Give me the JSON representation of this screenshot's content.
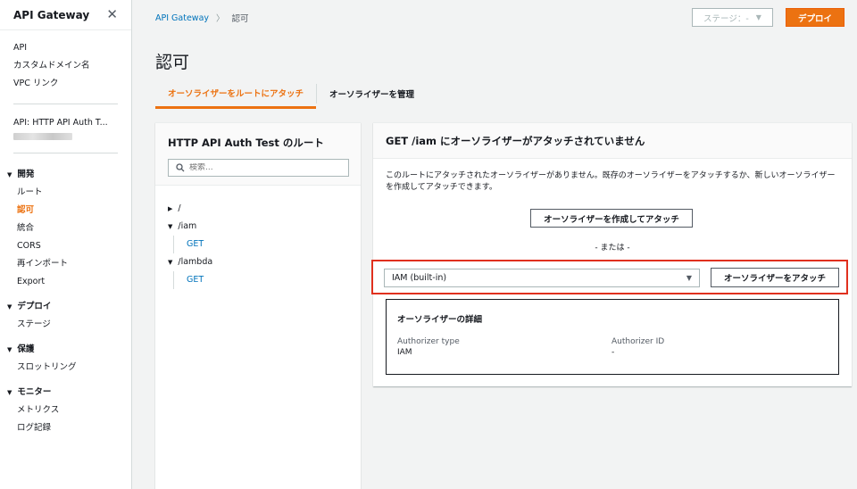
{
  "sidebar": {
    "title": "API Gateway",
    "top_links": [
      "API",
      "カスタムドメイン名",
      "VPC リンク"
    ],
    "api_name": "API: HTTP API Auth T...",
    "groups": [
      {
        "label": "開発",
        "items": [
          "ルート",
          "認可",
          "統合",
          "CORS",
          "再インポート",
          "Export"
        ]
      },
      {
        "label": "デプロイ",
        "items": [
          "ステージ"
        ]
      },
      {
        "label": "保護",
        "items": [
          "スロットリング"
        ]
      },
      {
        "label": "モニター",
        "items": [
          "メトリクス",
          "ログ記録"
        ]
      }
    ],
    "active_item": "認可"
  },
  "breadcrumb": {
    "root": "API Gateway",
    "current": "認可"
  },
  "stage_select": {
    "label": "ステージ：-"
  },
  "deploy_button": "デプロイ",
  "page_title": "認可",
  "tabs": [
    "オーソライザーをルートにアタッチ",
    "オーソライザーを管理"
  ],
  "routes_panel": {
    "title": "HTTP API Auth Test のルート",
    "search_placeholder": "検索...",
    "routes": [
      {
        "path": "/",
        "expanded": false,
        "methods": []
      },
      {
        "path": "/iam",
        "expanded": true,
        "methods": [
          "GET"
        ]
      },
      {
        "path": "/lambda",
        "expanded": true,
        "methods": [
          "GET"
        ]
      }
    ]
  },
  "detail_panel": {
    "title": "GET /iam にオーソライザーがアタッチされていません",
    "description": "このルートにアタッチされたオーソライザーがありません。既存のオーソライザーをアタッチするか、新しいオーソライザーを作成してアタッチできます。",
    "create_button": "オーソライザーを作成してアタッチ",
    "or_text": "- または -",
    "authorizer_select": "IAM (built-in)",
    "attach_button": "オーソライザーをアタッチ",
    "info": {
      "title": "オーソライザーの詳細",
      "type_label": "Authorizer type",
      "type_value": "IAM",
      "id_label": "Authorizer ID",
      "id_value": "-"
    }
  },
  "colors": {
    "accent": "#ec7211",
    "link": "#0073bb",
    "highlight": "#e0301e"
  }
}
